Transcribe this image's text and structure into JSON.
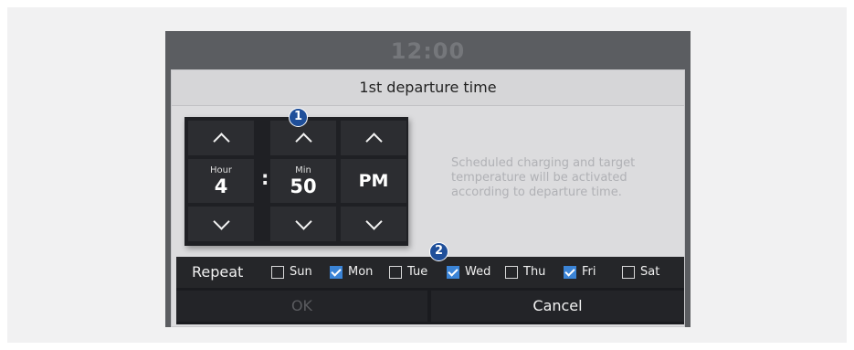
{
  "clock": "12:00",
  "dialog": {
    "title": "1st departure time",
    "description": "Scheduled charging and target temperature will be activated according to departure time."
  },
  "picker": {
    "hour": {
      "label": "Hour",
      "value": "4"
    },
    "minute": {
      "label": "Min",
      "value": "50"
    },
    "period": {
      "value": "PM"
    },
    "separator": ":"
  },
  "repeat": {
    "label": "Repeat",
    "days": [
      {
        "label": "Sun",
        "checked": false
      },
      {
        "label": "Mon",
        "checked": true
      },
      {
        "label": "Tue",
        "checked": false
      },
      {
        "label": "Wed",
        "checked": true
      },
      {
        "label": "Thu",
        "checked": false
      },
      {
        "label": "Fri",
        "checked": true
      },
      {
        "label": "Sat",
        "checked": false
      }
    ]
  },
  "buttons": {
    "ok": "OK",
    "cancel": "Cancel"
  },
  "callouts": [
    "1",
    "2"
  ],
  "icons": {
    "up": "chevron-up-icon",
    "down": "chevron-down-icon",
    "check": "checkmark-icon"
  },
  "colors": {
    "accent": "#3b84d6",
    "callout": "#1f4f9a"
  }
}
